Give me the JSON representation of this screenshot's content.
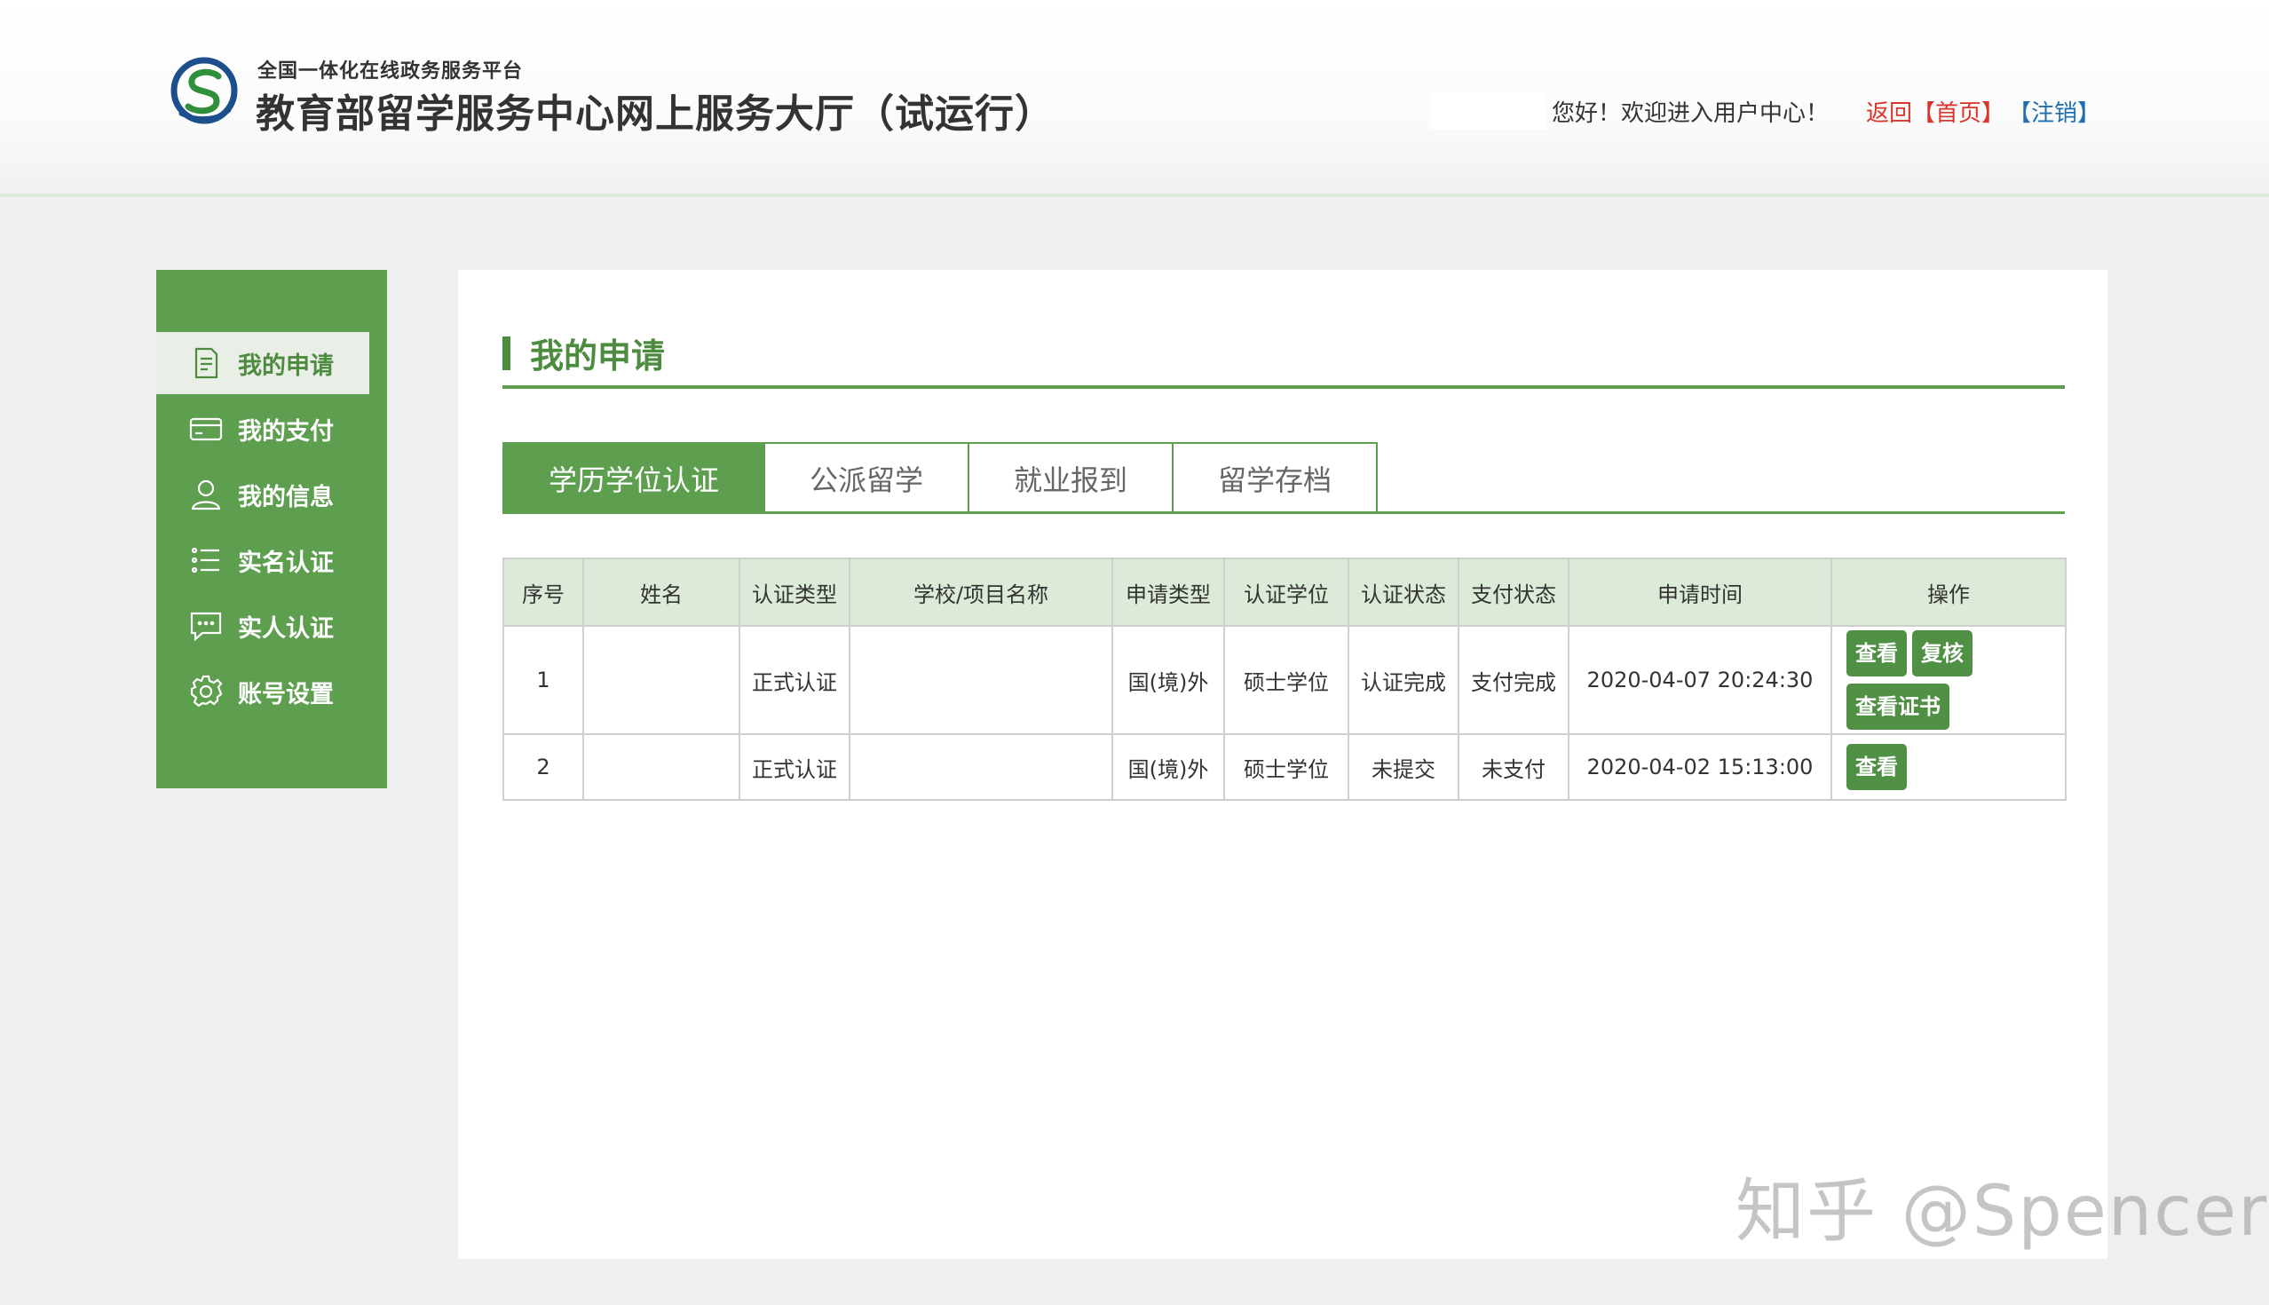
{
  "header": {
    "platform": "全国一体化在线政务服务平台",
    "title": "教育部留学服务中心网上服务大厅（试运行）",
    "welcome": "您好！欢迎进入用户中心！",
    "back": "返回",
    "home": "【首页】",
    "logout": "【注销】"
  },
  "sidebar": {
    "items": [
      {
        "label": "我的申请",
        "icon": "document-icon",
        "active": true
      },
      {
        "label": "我的支付",
        "icon": "card-icon"
      },
      {
        "label": "我的信息",
        "icon": "user-icon"
      },
      {
        "label": "实名认证",
        "icon": "list-icon"
      },
      {
        "label": "实人认证",
        "icon": "chat-icon"
      },
      {
        "label": "账号设置",
        "icon": "gear-icon"
      }
    ]
  },
  "main": {
    "title": "我的申请",
    "tabs": [
      {
        "label": "学历学位认证",
        "active": true
      },
      {
        "label": "公派留学"
      },
      {
        "label": "就业报到"
      },
      {
        "label": "留学存档"
      }
    ],
    "table": {
      "columns": [
        "序号",
        "姓名",
        "认证类型",
        "学校/项目名称",
        "申请类型",
        "认证学位",
        "认证状态",
        "支付状态",
        "申请时间",
        "操作"
      ],
      "rows": [
        {
          "no": "1",
          "name": "",
          "cert_type": "正式认证",
          "school": "",
          "apply_type": "国(境)外",
          "degree": "硕士学位",
          "status": "认证完成",
          "pay_status": "支付完成",
          "time": "2020-04-07 20:24:30",
          "actions": [
            "查看",
            "复核",
            "查看证书"
          ]
        },
        {
          "no": "2",
          "name": "",
          "cert_type": "正式认证",
          "school": "",
          "apply_type": "国(境)外",
          "degree": "硕士学位",
          "status": "未提交",
          "pay_status": "未支付",
          "time": "2020-04-02 15:13:00",
          "actions": [
            "查看"
          ]
        }
      ]
    }
  },
  "watermark": "知乎 @Spencer",
  "colors": {
    "primary_green": "#5d9e4f",
    "status_done": "#2e9e3e",
    "status_pending": "#4a9ed6",
    "link_red": "#d9362b",
    "link_blue": "#1f6fb2"
  }
}
